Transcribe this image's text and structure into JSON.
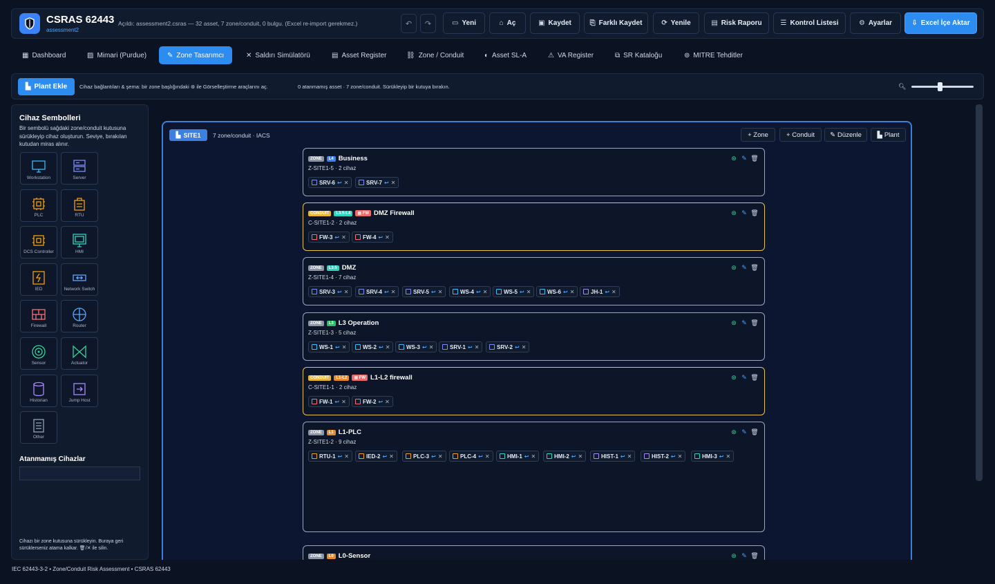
{
  "header": {
    "app_title": "CSRAS 62443",
    "app_subtitle": "assessment2",
    "opened_info": "Açıldı: assessment2.csras — 32 asset, 7 zone/conduit, 0 bulgu. (Excel re-import gerekmez.)",
    "buttons": [
      {
        "label": "Yeni",
        "icon": "new-file-icon"
      },
      {
        "label": "Aç",
        "icon": "open-folder-icon"
      },
      {
        "label": "Kaydet",
        "icon": "save-icon"
      },
      {
        "label": "Farklı Kaydet",
        "icon": "save-as-icon"
      },
      {
        "label": "Yenile",
        "icon": "refresh-icon"
      },
      {
        "label": "Risk Raporu",
        "icon": "report-icon"
      },
      {
        "label": "Kontrol Listesi",
        "icon": "checklist-icon"
      },
      {
        "label": "Ayarlar",
        "icon": "gear-icon"
      },
      {
        "label": "Excel İçe Aktar",
        "icon": "import-icon"
      }
    ]
  },
  "tabs": [
    {
      "label": "Dashboard",
      "icon": "dashboard-icon"
    },
    {
      "label": "Mimari (Purdue)",
      "icon": "architecture-icon"
    },
    {
      "label": "Zone Tasarımcı",
      "icon": "pencil-icon",
      "active": true
    },
    {
      "label": "Saldırı Simülatörü",
      "icon": "crosshair-icon"
    },
    {
      "label": "Asset Register",
      "icon": "register-icon"
    },
    {
      "label": "Zone / Conduit",
      "icon": "link-icon"
    },
    {
      "label": "Asset SL-A",
      "icon": "shield-icon"
    },
    {
      "label": "VA Register",
      "icon": "warning-icon"
    },
    {
      "label": "SR Kataloğu",
      "icon": "catalog-icon"
    },
    {
      "label": "MITRE Tehditler",
      "icon": "target-icon"
    }
  ],
  "toolbar": {
    "plant_button": "Plant Ekle",
    "hint_a": "Cihaz bağlantıları & şema: bir zone başlığındaki",
    "hint_b": "ile Görselleştirme araçlarını aç.",
    "status": "0 atanmamış asset · 7 zone/conduit. Sürükleyip bir kutuya bırakın.",
    "zoom_fraction": 0.45
  },
  "left_panel": {
    "title": "Cihaz Sembolleri",
    "description": "Bir sembolü sağdaki zone/conduit kutusuna sürükleyip cihaz oluşturun. Seviye, bırakılan kutudan miras alınır.",
    "symbols": [
      {
        "label": "Workstation",
        "icon": "workstation-icon",
        "color": "#38bdf8"
      },
      {
        "label": "Server",
        "icon": "server-icon",
        "color": "#818cf8"
      },
      {
        "label": "PLC",
        "icon": "plc-icon",
        "color": "#f59e0b"
      },
      {
        "label": "RTU",
        "icon": "rtu-icon",
        "color": "#f59e0b"
      },
      {
        "label": "DCS Controller",
        "icon": "dcs-controller-icon",
        "color": "#f59e0b"
      },
      {
        "label": "HMI",
        "icon": "hmi-icon",
        "color": "#2dd4bf"
      },
      {
        "label": "IED",
        "icon": "ied-icon",
        "color": "#f59e0b"
      },
      {
        "label": "Network Switch",
        "icon": "network-switch-icon",
        "color": "#60a5fa"
      },
      {
        "label": "Firewall",
        "icon": "firewall-icon",
        "color": "#f87171"
      },
      {
        "label": "Router",
        "icon": "router-icon",
        "color": "#60a5fa"
      },
      {
        "label": "Sensor",
        "icon": "sensor-icon",
        "color": "#34d399"
      },
      {
        "label": "Actuator",
        "icon": "actuator-icon",
        "color": "#34d399"
      },
      {
        "label": "Historian",
        "icon": "historian-icon",
        "color": "#a78bfa"
      },
      {
        "label": "Jump Host",
        "icon": "jump-host-icon",
        "color": "#a78bfa"
      },
      {
        "label": "Other",
        "icon": "other-icon",
        "color": "#94a3b8"
      }
    ],
    "unassigned_title": "Atanmamış Cihazlar",
    "footer_a": "Cihazı bir zone kutusuna sürükleyin. Buraya geri sürüklerseniz atama kalkar.",
    "footer_b": "/✕ ile silin."
  },
  "site": {
    "tag": "SITE1",
    "subtitle": "7 zone/conduit · IACS",
    "buttons": [
      "+ Zone",
      "+ Conduit",
      "Düzenle",
      "Plant"
    ],
    "boxes": [
      {
        "kind": "ZONE",
        "level": "L4",
        "level_color": "#3b82f6",
        "fw": "",
        "name": "Business",
        "meta": "Z-SITE1-5 · 2 cihaz",
        "devices": [
          {
            "n": "SRV-6",
            "t": "server"
          },
          {
            "n": "SRV-7",
            "t": "server"
          }
        ]
      },
      {
        "kind": "CONDUIT",
        "level": "L3.5-L4",
        "level_color": "#2dd4bf",
        "fw": "FW",
        "name": "DMZ Firewall",
        "meta": "C-SITE1-2 · 2 cihaz",
        "devices": [
          {
            "n": "FW-3",
            "t": "firewall"
          },
          {
            "n": "FW-4",
            "t": "firewall"
          }
        ]
      },
      {
        "kind": "ZONE",
        "level": "L3.5",
        "level_color": "#2dd4bf",
        "fw": "",
        "name": "DMZ",
        "meta": "Z-SITE1-4 · 7 cihaz",
        "devices": [
          {
            "n": "SRV-3",
            "t": "server"
          },
          {
            "n": "SRV-4",
            "t": "server"
          },
          {
            "n": "SRV-5",
            "t": "server"
          },
          {
            "n": "WS-4",
            "t": "workstation"
          },
          {
            "n": "WS-5",
            "t": "workstation"
          },
          {
            "n": "WS-6",
            "t": "workstation"
          },
          {
            "n": "JH-1",
            "t": "jumphost"
          }
        ]
      },
      {
        "kind": "ZONE",
        "level": "L3",
        "level_color": "#22c55e",
        "fw": "",
        "name": "L3 Operation",
        "meta": "Z-SITE1-3 · 5 cihaz",
        "devices": [
          {
            "n": "WS-1",
            "t": "workstation"
          },
          {
            "n": "WS-2",
            "t": "workstation"
          },
          {
            "n": "WS-3",
            "t": "workstation"
          },
          {
            "n": "SRV-1",
            "t": "server"
          },
          {
            "n": "SRV-2",
            "t": "server"
          }
        ]
      },
      {
        "kind": "CONDUIT",
        "level": "L1-L2",
        "level_color": "#e8892b",
        "fw": "FW",
        "name": "L1-L2 firewall",
        "meta": "C-SITE1-1 · 2 cihaz",
        "devices": [
          {
            "n": "FW-1",
            "t": "firewall"
          },
          {
            "n": "FW-2",
            "t": "firewall"
          }
        ]
      },
      {
        "kind": "ZONE",
        "level": "L1",
        "level_color": "#e8892b",
        "fw": "",
        "name": "L1-PLC",
        "meta": "Z-SITE1-2 · 9 cihaz",
        "devices": [
          {
            "n": "RTU-1",
            "t": "rtu"
          },
          {
            "n": "IED-2",
            "t": "ied"
          },
          {
            "n": "PLC-3",
            "t": "plc"
          },
          {
            "n": "PLC-4",
            "t": "plc"
          },
          {
            "n": "HMI-1",
            "t": "hmi"
          },
          {
            "n": "HMI-2",
            "t": "hmi"
          },
          {
            "n": "HIST-1",
            "t": "historian"
          },
          {
            "n": "HIST-2",
            "t": "historian"
          },
          {
            "n": "HMI-3",
            "t": "hmi"
          }
        ]
      },
      {
        "kind": "ZONE",
        "level": "L0",
        "level_color": "#e8892b",
        "fw": "",
        "name": "L0-Sensor",
        "meta": "",
        "devices": []
      }
    ]
  },
  "footer": "IEC 62443-3-2 • Zone/Conduit Risk Assessment • CSRAS 62443",
  "colors": {
    "accent": "#2d8cf0",
    "zone_border": "#9aa7bd",
    "conduit_border": "#e6c34a",
    "site_border": "#3e7fd8"
  }
}
